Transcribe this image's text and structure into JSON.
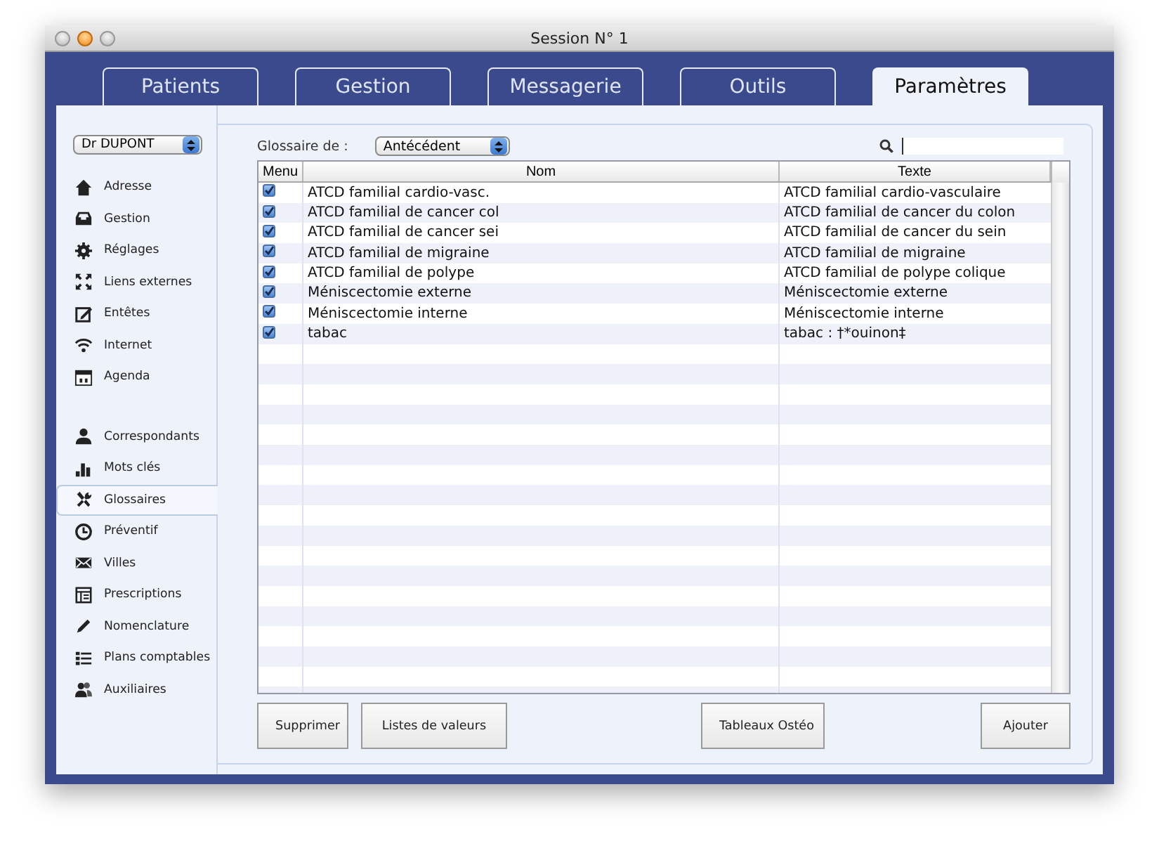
{
  "window": {
    "title": "Session N° 1"
  },
  "tabs": [
    {
      "label": "Patients",
      "selected": false
    },
    {
      "label": "Gestion",
      "selected": false
    },
    {
      "label": "Messagerie",
      "selected": false
    },
    {
      "label": "Outils",
      "selected": false
    },
    {
      "label": "Paramètres",
      "selected": true
    }
  ],
  "sidebar": {
    "doctor_select": "Dr DUPONT",
    "groups": [
      [
        {
          "label": "Adresse",
          "selected": false
        },
        {
          "label": "Gestion",
          "selected": false
        },
        {
          "label": "Réglages",
          "selected": false
        },
        {
          "label": "Liens externes",
          "selected": false
        },
        {
          "label": "Entêtes",
          "selected": false
        },
        {
          "label": "Internet",
          "selected": false
        },
        {
          "label": "Agenda",
          "selected": false
        }
      ],
      [
        {
          "label": "Correspondants",
          "selected": false
        },
        {
          "label": "Mots clés",
          "selected": false
        },
        {
          "label": "Glossaires",
          "selected": true
        },
        {
          "label": "Préventif",
          "selected": false
        },
        {
          "label": "Villes",
          "selected": false
        },
        {
          "label": "Prescriptions",
          "selected": false
        },
        {
          "label": "Nomenclature",
          "selected": false
        },
        {
          "label": "Plans comptables",
          "selected": false
        },
        {
          "label": "Auxiliaires",
          "selected": false
        }
      ]
    ]
  },
  "glossary": {
    "label": "Glossaire de :",
    "select": "Antécédent"
  },
  "table": {
    "columns": [
      "Menu",
      "Nom",
      "Texte"
    ],
    "rows": [
      {
        "menu": true,
        "nom": "ATCD familial cardio-vasc.",
        "texte": "ATCD familial cardio-vasculaire"
      },
      {
        "menu": true,
        "nom": "ATCD familial de cancer col",
        "texte": "ATCD familial de cancer du colon"
      },
      {
        "menu": true,
        "nom": "ATCD familial de cancer sei",
        "texte": "ATCD familial de cancer du sein"
      },
      {
        "menu": true,
        "nom": "ATCD familial de migraine",
        "texte": "ATCD familial de migraine"
      },
      {
        "menu": true,
        "nom": "ATCD familial de polype",
        "texte": "ATCD familial de polype colique"
      },
      {
        "menu": true,
        "nom": "Méniscectomie externe",
        "texte": "Méniscectomie externe"
      },
      {
        "menu": true,
        "nom": "Méniscectomie interne",
        "texte": "Méniscectomie interne"
      },
      {
        "menu": true,
        "nom": "tabac",
        "texte": "tabac : †*ouinon‡"
      }
    ]
  },
  "buttons": [
    "Supprimer",
    "Listes de valeurs",
    "Tableaux Ostéo",
    "Ajouter"
  ]
}
